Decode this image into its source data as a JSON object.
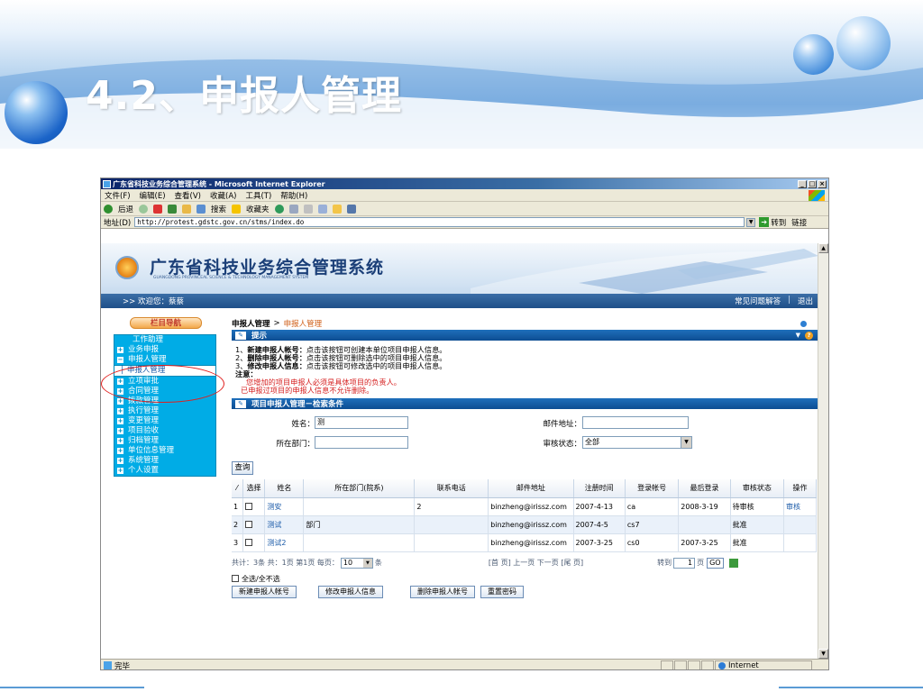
{
  "slide": {
    "title": "4.2、申报人管理"
  },
  "browser": {
    "window_title": "广东省科技业务综合管理系统 - Microsoft Internet Explorer",
    "menu": [
      "文件(F)",
      "编辑(E)",
      "查看(V)",
      "收藏(A)",
      "工具(T)",
      "帮助(H)"
    ],
    "toolbar": {
      "back": "后退",
      "search": "搜索",
      "favorites": "收藏夹"
    },
    "address_label": "地址(D)",
    "address_value": "http://protest.gdstc.gov.cn/stms/index.do",
    "go_label": "转到",
    "links_label": "链接",
    "status_text": "完毕",
    "zone_text": "Internet"
  },
  "app": {
    "title": "广东省科技业务综合管理系统",
    "subtitle": "GUANGDONG PROVINCEAL SCIENCE & TECHNOLOGY MANAGEMENT SYSTEM",
    "welcome": ">> 欢迎您：蔡蔡",
    "top_links": [
      "常见问题解答",
      "退出"
    ],
    "top_sep": "|"
  },
  "sidebar": {
    "header": "栏目导航",
    "items": [
      {
        "label": "工作助理",
        "type": "plain"
      },
      {
        "label": "业务申报",
        "type": "plus"
      },
      {
        "label": "申报人管理",
        "type": "minus"
      },
      {
        "label": "├ 申报人管理",
        "type": "sub"
      },
      {
        "label": "立项审批",
        "type": "plus"
      },
      {
        "label": "合同管理",
        "type": "plus"
      },
      {
        "label": "拨款管理",
        "type": "plus"
      },
      {
        "label": "执行管理",
        "type": "plus"
      },
      {
        "label": "变更管理",
        "type": "plus"
      },
      {
        "label": "项目验收",
        "type": "plus"
      },
      {
        "label": "归档管理",
        "type": "plus"
      },
      {
        "label": "单位信息管理",
        "type": "plus"
      },
      {
        "label": "系统管理",
        "type": "plus"
      },
      {
        "label": "个人设置",
        "type": "plus"
      }
    ]
  },
  "content": {
    "breadcrumb_root": "申报人管理",
    "breadcrumb_sep": ">",
    "breadcrumb_current": "申报人管理",
    "tips_title": "提示",
    "tips": [
      {
        "bold": "新建申报人帐号：",
        "text": "点击该按钮可创建本单位项目申报人信息。",
        "num": "1、"
      },
      {
        "bold": "删除申报人帐号：",
        "text": "点击该按钮可删除选中的项目申报人信息。",
        "num": "2、"
      },
      {
        "bold": "修改申报人信息：",
        "text": "点击该按钮可修改选中的项目申报人信息。",
        "num": "3、"
      }
    ],
    "note_label": "注意：",
    "notes": [
      "您增加的项目申报人必须是具体项目的负责人。",
      "已申报过项目的申报人信息不允许删除。"
    ],
    "search_title": "项目申报人管理－检索条件",
    "form": {
      "name_label": "姓名：",
      "name_value": "测",
      "dept_label": "所在部门：",
      "dept_value": "",
      "email_label": "邮件地址：",
      "email_value": "",
      "status_label": "审核状态：",
      "status_value": "全部"
    },
    "query_button": "查询",
    "table": {
      "headers": [
        "",
        "选择",
        "姓名",
        "所在部门(院系)",
        "联系电话",
        "邮件地址",
        "注册时间",
        "登录帐号",
        "最后登录",
        "审核状态",
        "操作"
      ],
      "rows": [
        {
          "no": "1",
          "name": "测安",
          "dept": "",
          "phone": "2",
          "email": "binzheng@irissz.com",
          "reg": "2007-4-13",
          "account": "ca",
          "last": "2008-3-19",
          "status": "待审核",
          "op": "审核"
        },
        {
          "no": "2",
          "name": "测试",
          "dept": "部门",
          "phone": "",
          "email": "binzheng@irissz.com",
          "reg": "2007-4-5",
          "account": "cs7",
          "last": "",
          "status": "批准",
          "op": ""
        },
        {
          "no": "3",
          "name": "测试2",
          "dept": "",
          "phone": "",
          "email": "binzheng@irissz.com",
          "reg": "2007-3-25",
          "account": "cs0",
          "last": "2007-3-25",
          "status": "批准",
          "op": ""
        }
      ]
    },
    "pager": {
      "summary": "共计：3条 共：1页 第1页 每页：",
      "page_size": "10",
      "unit": "条",
      "nav": "[首 页] 上一页 下一页 [尾 页]",
      "goto_label": "转到",
      "goto_value": "1",
      "page_unit": "页",
      "go_button": "GO"
    },
    "select_all": "全选/全不选",
    "actions": [
      "新建申报人帐号",
      "修改申报人信息",
      "删除申报人帐号",
      "重置密码"
    ]
  }
}
